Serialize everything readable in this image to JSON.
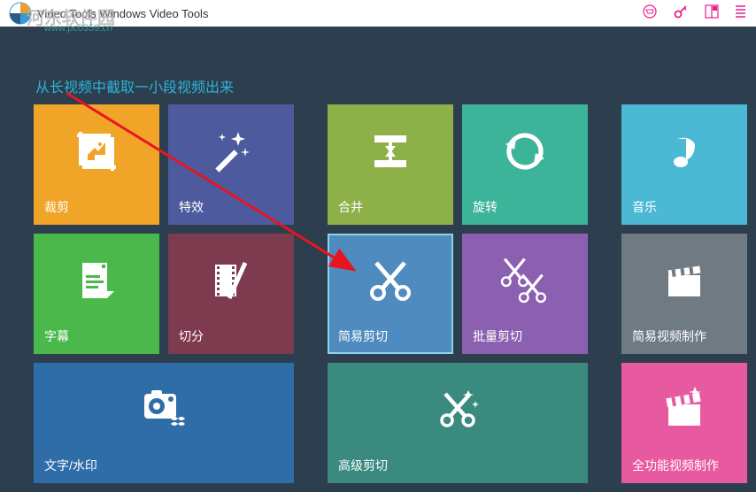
{
  "titlebar": {
    "title": "Video Tools Windows Video Tools"
  },
  "watermark": {
    "text1": "河东软件园",
    "text2": "www.pc0359.cn"
  },
  "annotation": "从长视频中截取一小段视频出来",
  "tiles": {
    "crop": "裁剪",
    "effects": "特效",
    "merge": "合并",
    "rotate": "旋转",
    "music": "音乐",
    "subtitle": "字幕",
    "split": "切分",
    "simpleCut": "简易剪切",
    "batchCut": "批量剪切",
    "simpleVideoMake": "简易视频制作",
    "textWatermark": "文字/水印",
    "advancedCut": "高级剪切",
    "fullVideoMake": "全功能视频制作"
  }
}
